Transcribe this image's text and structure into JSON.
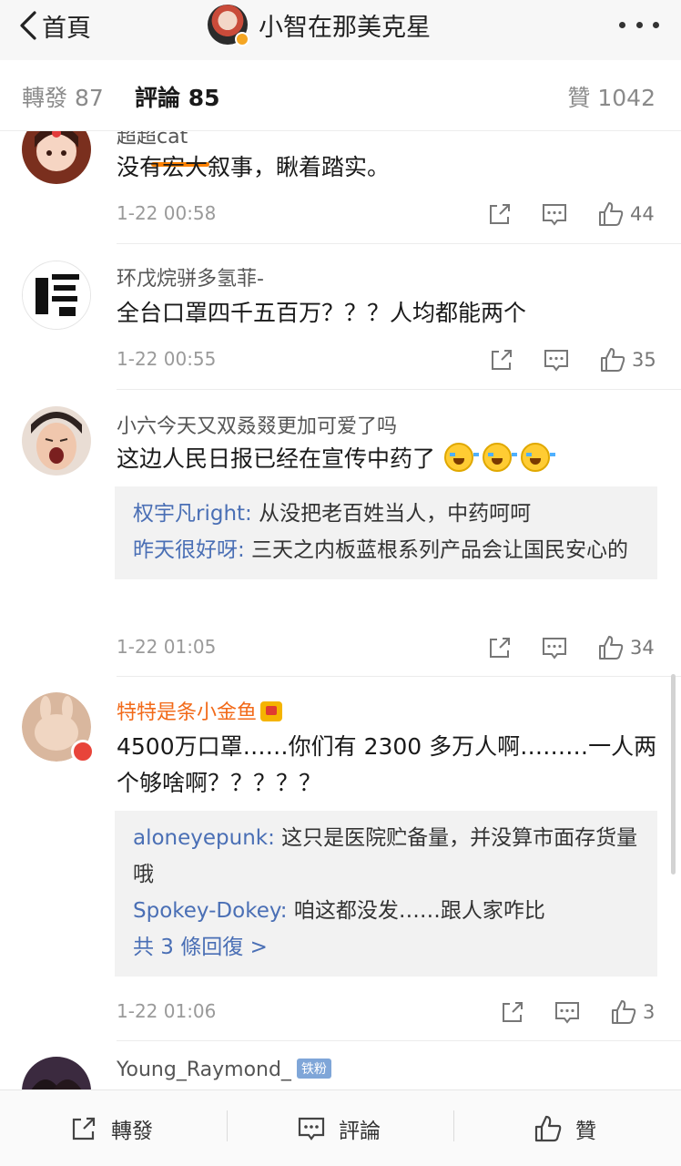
{
  "navbar": {
    "back_label": "首頁",
    "title": "小智在那美克星"
  },
  "tabs": {
    "repost": "轉發 87",
    "comments": "評論 85",
    "likes": "贊 1042"
  },
  "comments": [
    {
      "username": "超超cat",
      "text": "没有宏大叙事，瞅着踏实。",
      "time": "1-22 00:58",
      "likes": "44"
    },
    {
      "username": "环戊烷骈多氢菲-",
      "text": "全台口罩四千五百万？？？人均都能两个",
      "time": "1-22 00:55",
      "likes": "35"
    },
    {
      "username": "小六今天又双叒叕更加可爱了吗",
      "text": "这边人民日报已经在宣传中药了",
      "emoji_name": "crying-laughing-emoji",
      "replies": [
        {
          "name": "权宇凡right:",
          "text": " 从没把老百姓当人，中药呵呵"
        },
        {
          "name": "昨天很好呀:",
          "text": " 三天之内板蓝根系列产品会让国民安心的"
        }
      ],
      "time": "1-22 01:05",
      "likes": "34"
    },
    {
      "username": "特特是条小金鱼",
      "text": "4500万口罩……你们有 2300 多万人啊………一人两个够啥啊？？？？？",
      "replies": [
        {
          "name": "aloneyepunk:",
          "text": " 这只是医院贮备量，并没算市面存货量哦"
        },
        {
          "name": "Spokey-Dokey:",
          "text": " 咱这都没发……跟人家咋比"
        }
      ],
      "more_replies": "共 3 條回復 >",
      "time": "1-22 01:06",
      "likes": "3"
    },
    {
      "username": "Young_Raymond_",
      "badge": "铁粉"
    }
  ],
  "bottombar": {
    "repost": "轉發",
    "comment": "評論",
    "like": "贊"
  },
  "colors": {
    "accent": "#ff8200",
    "link": "#4a6fb5",
    "vip_name": "#f26a19"
  }
}
